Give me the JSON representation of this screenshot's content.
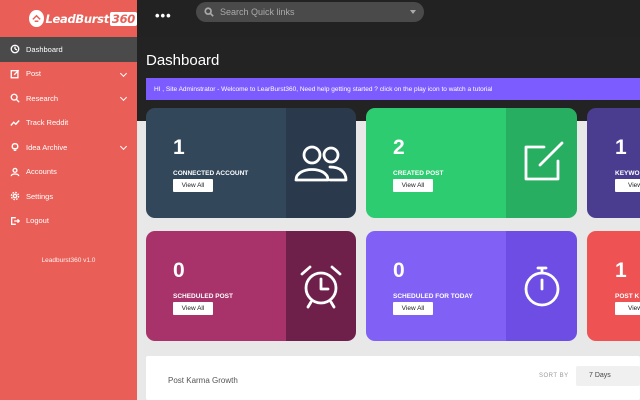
{
  "brand": {
    "name": "LeadBurst",
    "suffix": "360"
  },
  "sidebar": {
    "items": [
      {
        "label": "Dashboard",
        "icon": "dashboard-icon",
        "active": true,
        "has_submenu": false
      },
      {
        "label": "Post",
        "icon": "post-icon",
        "active": false,
        "has_submenu": true
      },
      {
        "label": "Research",
        "icon": "search-icon",
        "active": false,
        "has_submenu": true
      },
      {
        "label": "Track Reddit",
        "icon": "trend-icon",
        "active": false,
        "has_submenu": false
      },
      {
        "label": "Idea Archive",
        "icon": "lightbulb-icon",
        "active": false,
        "has_submenu": true
      },
      {
        "label": "Accounts",
        "icon": "user-icon",
        "active": false,
        "has_submenu": false
      },
      {
        "label": "Settings",
        "icon": "gear-icon",
        "active": false,
        "has_submenu": false
      },
      {
        "label": "Logout",
        "icon": "logout-icon",
        "active": false,
        "has_submenu": false
      }
    ],
    "version": "Leadburst360 v1.0"
  },
  "topbar": {
    "menu_icon": "more-dots-icon",
    "search_placeholder": "Search Quick links"
  },
  "page": {
    "title": "Dashboard",
    "welcome": "HI , Site Adminstrator - Welcome to LearBurst360, Need help getting started ? click on the play icon to watch a tutorial"
  },
  "cards": [
    {
      "value": "1",
      "label": "CONNECTED ACCOUNT",
      "button": "View All",
      "icon": "users-icon",
      "color": "#33475b",
      "icon_bg": "#2a3a4c"
    },
    {
      "value": "2",
      "label": "CREATED POST",
      "button": "View All",
      "icon": "edit-icon",
      "color": "#2ecc71",
      "icon_bg": "#27ae60"
    },
    {
      "value": "1",
      "label": "KEYWO",
      "button": "View",
      "icon": "",
      "color": "#4a3d8f",
      "icon_bg": "#3e327a"
    },
    {
      "value": "0",
      "label": "SCHEDULED POST",
      "button": "View All",
      "icon": "alarm-clock-icon",
      "color": "#a8336a",
      "icon_bg": "#6e1f4a"
    },
    {
      "value": "0",
      "label": "SCHEDULED FOR TODAY",
      "button": "View All",
      "icon": "stopwatch-icon",
      "color": "#8160f5",
      "icon_bg": "#6d4de3"
    },
    {
      "value": "1",
      "label": "POST K",
      "button": "View",
      "icon": "",
      "color": "#ee5253",
      "icon_bg": "#d94445"
    }
  ],
  "karma": {
    "title": "Post Karma Growth",
    "sort_label": "SORT BY",
    "sort_value": "7 Days"
  }
}
